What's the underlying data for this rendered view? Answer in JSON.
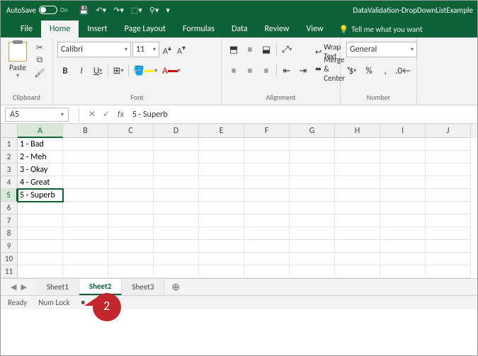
{
  "titlebar": {
    "autosave": "AutoSave",
    "toggle": "On",
    "doc": "DataValidation-DropDownListExample"
  },
  "qat": {
    "save": "💾",
    "undo": "↶",
    "redo": "↷",
    "arrow": "↗",
    "more": "⋯"
  },
  "tabs": {
    "file": "File",
    "home": "Home",
    "insert": "Insert",
    "pagelayout": "Page Layout",
    "formulas": "Formulas",
    "data": "Data",
    "review": "Review",
    "view": "View",
    "tellme": "Tell me what you want"
  },
  "ribbon": {
    "clipboard": {
      "paste": "Paste",
      "label": "Clipboard"
    },
    "font": {
      "name": "Calibri",
      "size": "11",
      "label": "Font"
    },
    "alignment": {
      "wrap": "Wrap Text",
      "merge": "Merge & Center",
      "label": "Alignment"
    },
    "number": {
      "format": "General",
      "label": "Number"
    }
  },
  "namebox": {
    "ref": "A5",
    "fx": "fx",
    "formula": "5 - Superb"
  },
  "columns": [
    "A",
    "B",
    "C",
    "D",
    "E",
    "F",
    "G",
    "H",
    "I",
    "J"
  ],
  "rows": [
    "1",
    "2",
    "3",
    "4",
    "5",
    "6",
    "7",
    "8",
    "9",
    "10",
    "11"
  ],
  "cells": {
    "A1": "1 - Bad",
    "A2": "2 - Meh",
    "A3": "3 - Okay",
    "A4": "4 - Great",
    "A5": "5 - Superb"
  },
  "selected": {
    "row": 5,
    "col": "A"
  },
  "callout": "2",
  "sheets": {
    "s1": "Sheet1",
    "s2": "Sheet2",
    "s3": "Sheet3",
    "active": "Sheet2"
  },
  "status": {
    "ready": "Ready",
    "numlock": "Num Lock"
  }
}
